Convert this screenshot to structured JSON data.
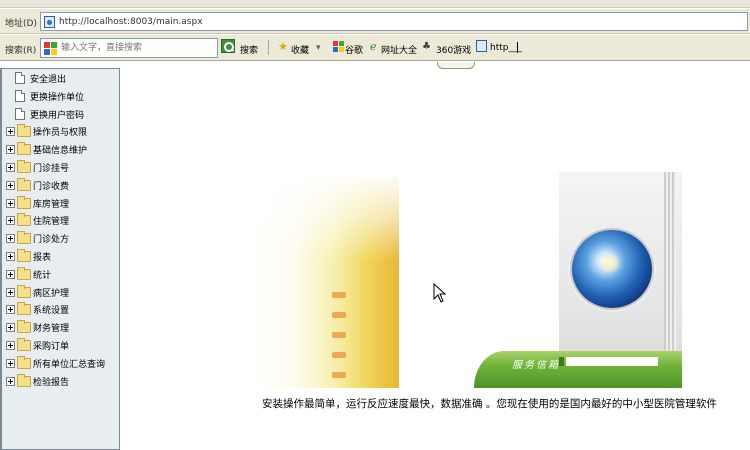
{
  "browser": {
    "address_label": "地址(D)",
    "url": "http://localhost:8003/main.aspx",
    "search_label": "搜索(R)",
    "search_placeholder": "输入文字，直接搜索",
    "search_button": "搜索",
    "toolbar": {
      "favorites": "收藏",
      "favorites_arrow": "▾",
      "google": "谷歌",
      "nav": "网址大全",
      "games": "360游戏",
      "link": "http___"
    }
  },
  "sidebar": {
    "items": [
      {
        "label": "安全退出",
        "type": "leaf"
      },
      {
        "label": "更换操作单位",
        "type": "leaf"
      },
      {
        "label": "更换用户密码",
        "type": "leaf"
      },
      {
        "label": "操作员与权限",
        "type": "branch"
      },
      {
        "label": "基础信息维护",
        "type": "branch"
      },
      {
        "label": "门诊挂号",
        "type": "branch"
      },
      {
        "label": "门诊收费",
        "type": "branch"
      },
      {
        "label": "库房管理",
        "type": "branch"
      },
      {
        "label": "住院管理",
        "type": "branch"
      },
      {
        "label": "门诊处方",
        "type": "branch"
      },
      {
        "label": "报表",
        "type": "branch"
      },
      {
        "label": "统计",
        "type": "branch"
      },
      {
        "label": "病区护理",
        "type": "branch"
      },
      {
        "label": "系统设置",
        "type": "branch"
      },
      {
        "label": "财务管理",
        "type": "branch"
      },
      {
        "label": "采购订单",
        "type": "branch"
      },
      {
        "label": "所有单位汇总查询",
        "type": "branch"
      },
      {
        "label": "检验报告",
        "type": "branch"
      }
    ]
  },
  "main": {
    "banner_service_label": "服务信箱",
    "tagline": "安装操作最简单，运行反应速度最快，数据准确 。您现在使用的是国内最好的中小型医院管理软件"
  },
  "colors": {
    "sidebar_bg": "#e8edf0",
    "toolbar_bg": "#ece9d8",
    "banner_green": "#6fb23a",
    "banner_yellow": "#efd65a"
  }
}
